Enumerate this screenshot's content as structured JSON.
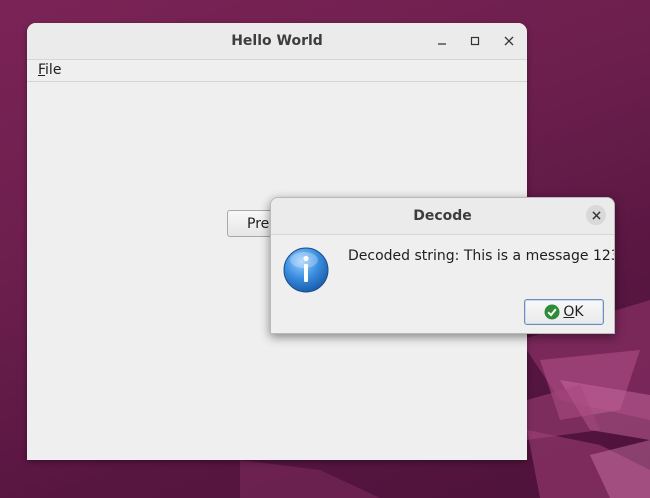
{
  "main_window": {
    "title": "Hello World",
    "menu": {
      "file_mnemonic": "F",
      "file_rest": "ile"
    },
    "button_partial_label": "Pre"
  },
  "dialog": {
    "title": "Decode",
    "message": "Decoded string: This is a message 123",
    "ok_mnemonic": "O",
    "ok_rest": "K",
    "icon": "info-icon"
  },
  "icons": {
    "minimize": "minimize-icon",
    "maximize": "maximize-icon",
    "close": "close-icon",
    "ok": "check-circle-icon"
  },
  "colors": {
    "desktop": "#6b1e4c",
    "window_bg": "#efefef",
    "info_blue": "#2a7fd6",
    "ok_green": "#2e8b3a"
  }
}
